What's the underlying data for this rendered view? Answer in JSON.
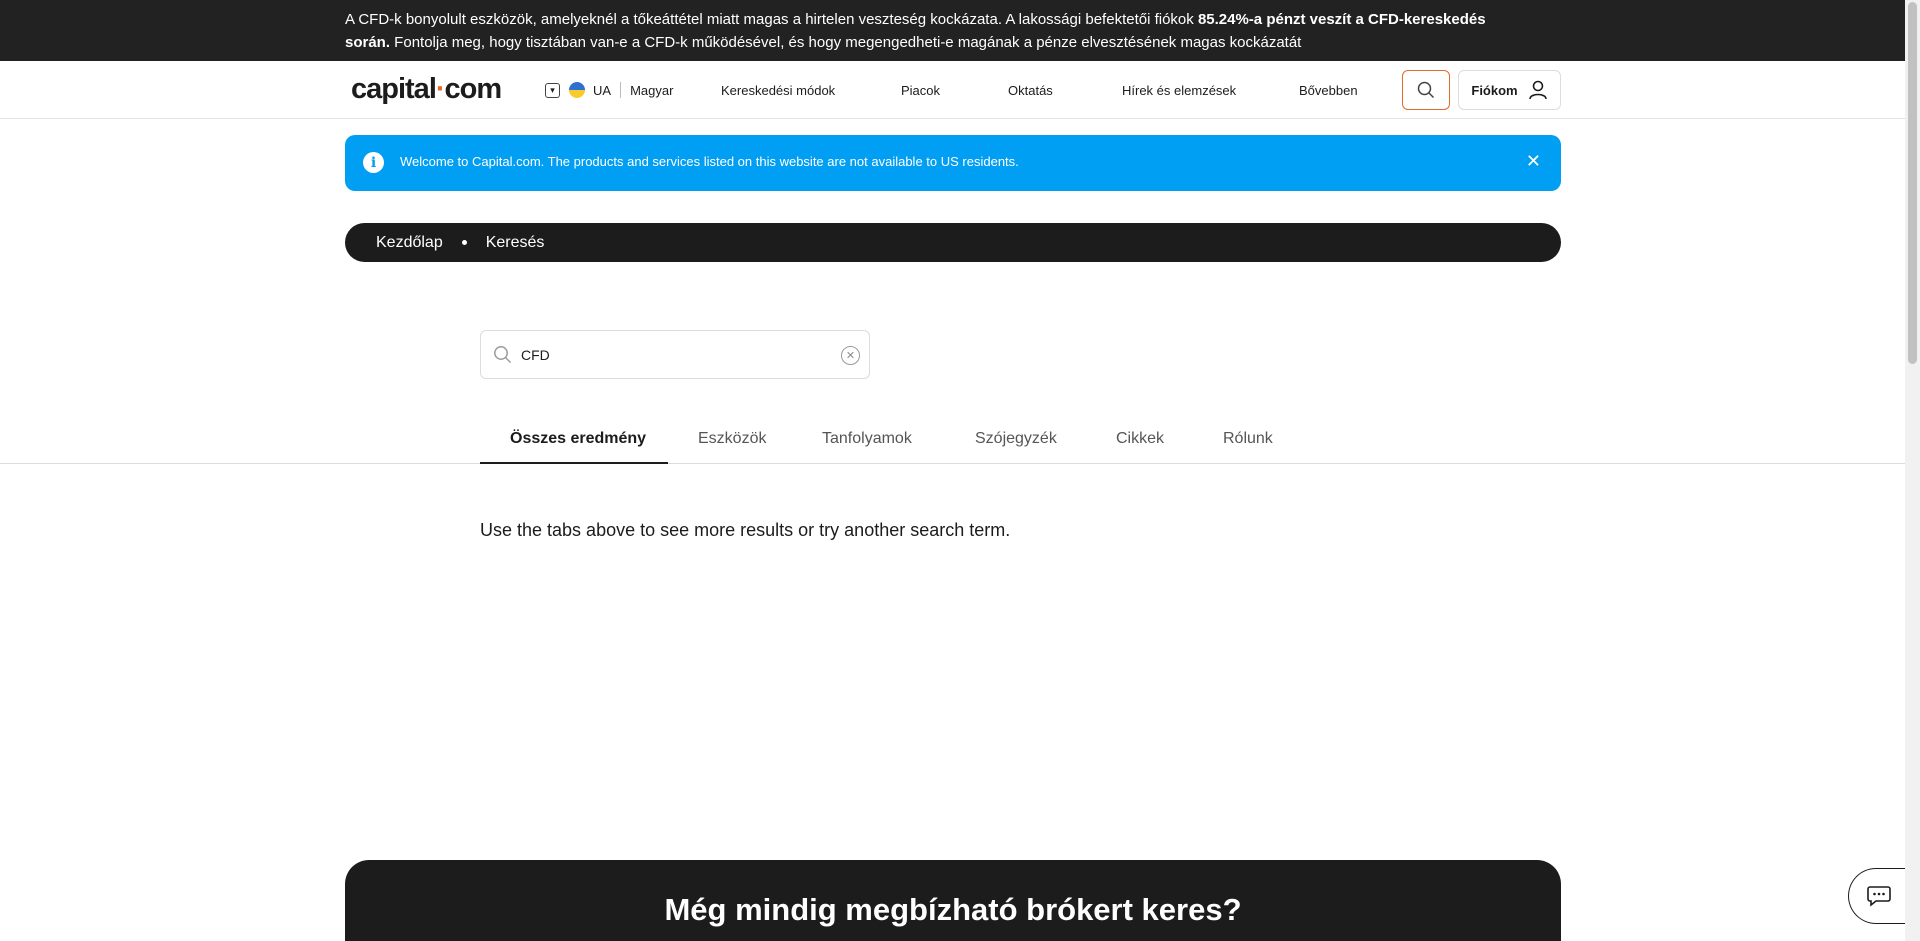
{
  "risk_banner": {
    "text_1": "A CFD-k bonyolult eszközök, amelyeknél a tőkeáttétel miatt magas a hirtelen veszteség kockázata. A lakossági befektetői fiókok ",
    "text_bold": "85.24%-a pénzt veszít a CFD-kereskedés során.",
    "text_2": " Fontolja meg, hogy tisztában van-e a CFD-k működésével, és hogy megengedheti-e magának a pénze elvesztésének magas kockázatát"
  },
  "header": {
    "logo_left": "capital",
    "logo_dot": "·",
    "logo_right": "com",
    "region": "UA",
    "language": "Magyar",
    "nav": [
      "Kereskedési módok",
      "Piacok",
      "Oktatás",
      "Hírek és elemzések",
      "Bővebben"
    ],
    "account_label": "Fiókom"
  },
  "notice": {
    "text": "Welcome to Capital.com. The products and services listed on this website are not available to US residents.",
    "close": "✕"
  },
  "breadcrumb": [
    "Kezdőlap",
    "Keresés"
  ],
  "search": {
    "value": "CFD"
  },
  "tabs": [
    "Összes eredmény",
    "Eszközök",
    "Tanfolyamok",
    "Szójegyzék",
    "Cikkek",
    "Rólunk"
  ],
  "active_tab": "Összes eredmény",
  "hint": "Use the tabs above to see more results or try another search term.",
  "promo": {
    "title": "Még mindig megbízható brókert keres?"
  },
  "colors": {
    "accent": "#e06c2b",
    "notice_bg": "#009ff4",
    "dark": "#1c1c1c"
  }
}
